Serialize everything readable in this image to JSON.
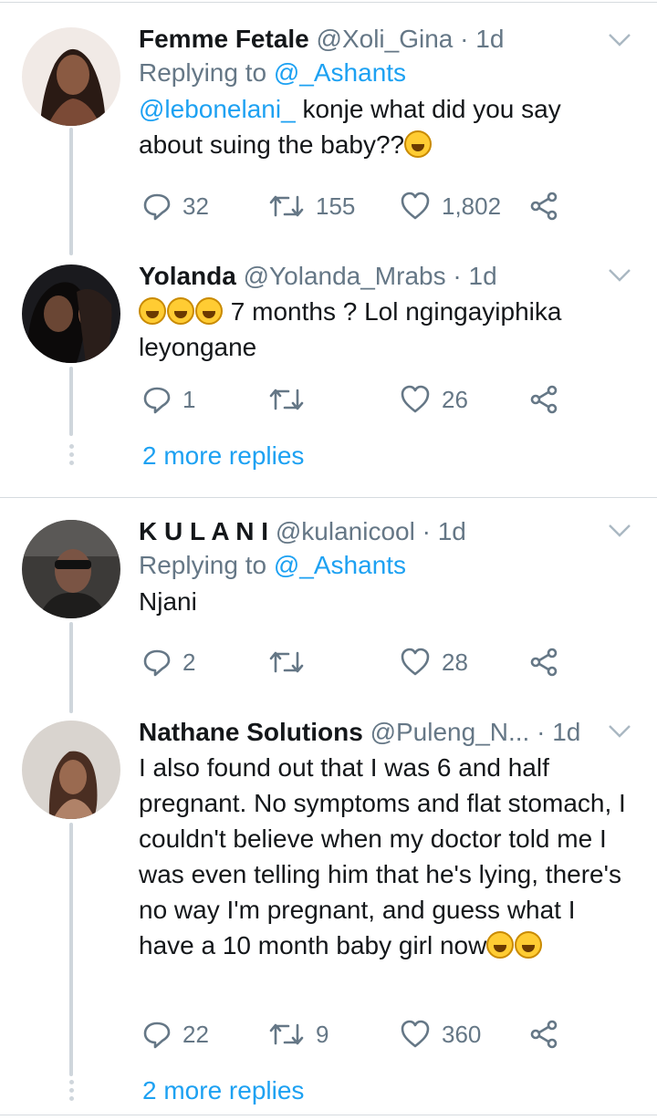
{
  "tweets": [
    {
      "name": "Femme Fetale",
      "handle": "@Xoli_Gina",
      "sep": "·",
      "time": "1d",
      "replying_prefix": "Replying to",
      "replying_to": "@_Ashants",
      "mention": "@lebonelani_",
      "text": " konje what did you say about suing the baby??",
      "emoji": [
        "crying-face"
      ],
      "replies": "32",
      "retweets": "155",
      "likes": "1,802"
    },
    {
      "name": "Yolanda",
      "handle": "@Yolanda_Mrabs",
      "sep": "·",
      "time": "1d",
      "emoji": [
        "tears-of-joy",
        "tears-of-joy",
        "woozy-face"
      ],
      "text": " 7 months ? Lol ngingayiphika leyongane",
      "replies": "1",
      "retweets": "",
      "likes": "26"
    },
    {
      "name": "K U L A N I",
      "handle": "@kulanicool",
      "sep": "·",
      "time": "1d",
      "replying_prefix": "Replying to",
      "replying_to": "@_Ashants",
      "text": "Njani",
      "replies": "2",
      "retweets": "",
      "likes": "28"
    },
    {
      "name": "Nathane Solutions",
      "handle": "@Puleng_N...",
      "sep": "·",
      "time": "1d",
      "text": "I also found out that I was 6 and half pregnant. No symptoms and flat stomach, I couldn't believe when my doctor told me I was even telling him that he's lying, there's no way I'm pregnant, and guess what I have a 10 month baby girl now",
      "emoji": [
        "tears-of-joy",
        "tears-of-joy"
      ],
      "replies": "22",
      "retweets": "9",
      "likes": "360"
    }
  ],
  "more_replies_1": "2 more replies",
  "more_replies_2": "2 more replies",
  "colors": {
    "link": "#1da1f2",
    "muted": "#657786",
    "text": "#14171a",
    "divider": "#d6dbdf"
  }
}
